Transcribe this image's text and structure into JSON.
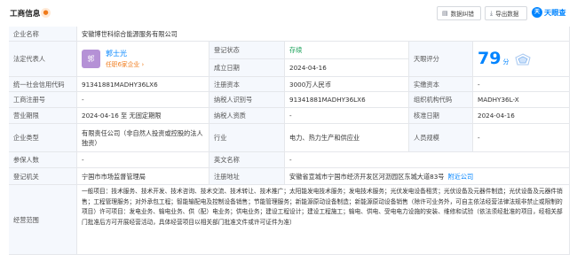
{
  "header": {
    "title": "工商信息",
    "info_badge": "●",
    "map_button": "数据纠错",
    "export_button": "导出数据",
    "logo_text": "天眼查",
    "logo_mark": "天"
  },
  "fields": {
    "company_name_label": "企业名称",
    "company_name": "安徽博世科综合能源服务有限公司",
    "legal_rep_label": "法定代表人",
    "legal_rep_avatar": "郭",
    "legal_rep_name": "郭士光",
    "legal_rep_sub": "任职6家企业 ›",
    "reg_status_label": "登记状态",
    "reg_status": "存续",
    "est_date_label": "成立日期",
    "est_date": "2024-04-16",
    "score_label": "天眼评分",
    "score_value": "79",
    "score_unit": "分",
    "credit_code_label": "统一社会信用代码",
    "credit_code": "91341881MADHY36LX6",
    "reg_capital_label": "注册资本",
    "reg_capital": "3000万人民币",
    "paid_capital_label": "实缴资本",
    "paid_capital": "-",
    "reg_no_label": "工商注册号",
    "reg_no": "-",
    "tax_id_label": "纳税人识别号",
    "tax_id": "91341881MADHY36LX6",
    "org_code_label": "组织机构代码",
    "org_code": "MADHY36L-X",
    "term_label": "营业期限",
    "term": "2024-04-16 至 无固定期限",
    "taxpayer_qual_label": "纳税人资质",
    "taxpayer_qual": "-",
    "approve_date_label": "核准日期",
    "approve_date": "2024-04-16",
    "company_type_label": "企业类型",
    "company_type": "有限责任公司（非自然人投资或控股的法人独资）",
    "industry_label": "行业",
    "industry": "电力、热力生产和供应业",
    "staff_size_label": "人员规模",
    "staff_size": "-",
    "insured_label": "参保人数",
    "insured": "-",
    "english_name_label": "英文名称",
    "english_name": "-",
    "reg_authority_label": "登记机关",
    "reg_authority": "宁国市市场监督管理局",
    "address_label": "注册地址",
    "address": "安徽省宣城市宁国市经济开发区河沥园区东城大道83号",
    "nearby_link": "附近公司",
    "scope_label": "经营范围",
    "scope": "一般项目：技术服务、技术开发、技术咨询、技术交流、技术转让、技术推广；太阳能发电技术服务；发电技术服务；光伏发电设备租赁；光伏设备及元器件制造；光伏设备及元器件销售；工程管理服务；对外承包工程；智能输配电及控制设备销售；节能管理服务；新能源原动设备制造；新能源原动设备销售（除许可业务外，可自主依法经营法律法规非禁止或限制的项目）许可项目：发电业务、输电业务、供（配）电业务；供电业务；建设工程设计；建设工程施工；输电、供电、受电电力设施的安装、维修和试验（依法须经批准的项目，经相关部门批准后方可开展经营活动，具体经营项目以相关部门批准文件或许可证件为准）"
  },
  "colors": {
    "label_bg": "#f5f8fd",
    "border": "#e5e7eb",
    "accent": "#0084ff",
    "status_green": "#18a058",
    "orange": "#f07b1b"
  }
}
